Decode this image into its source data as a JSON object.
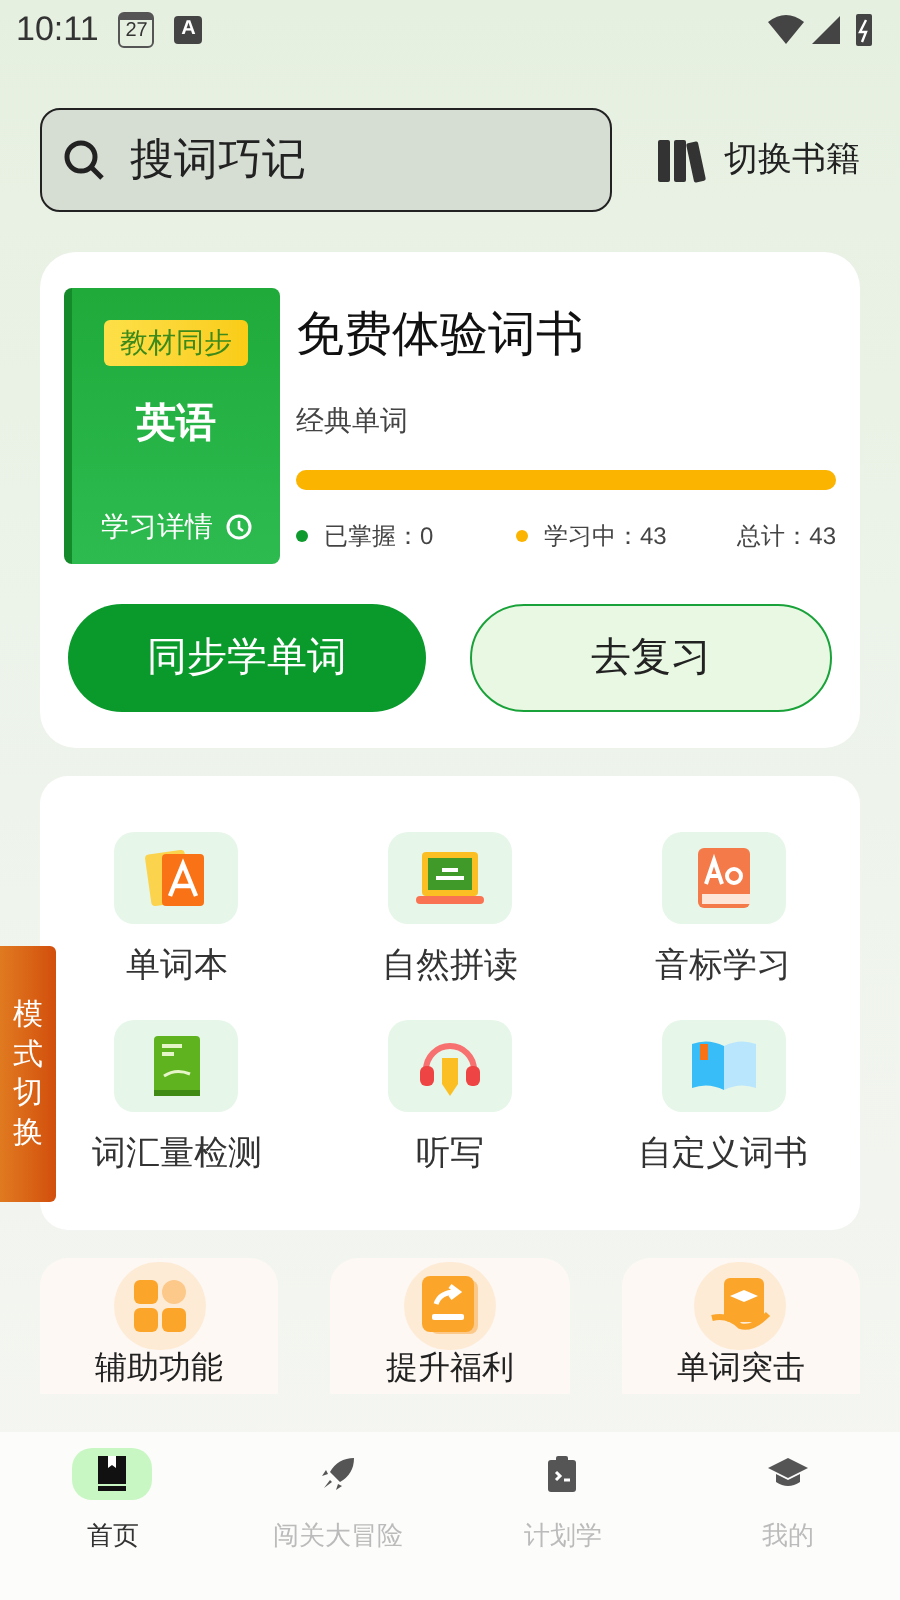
{
  "status_bar": {
    "time": "10:11",
    "calendar_day": "27",
    "notice_letter": "A"
  },
  "search": {
    "placeholder": "搜词巧记"
  },
  "switch_books": {
    "label": "切换书籍"
  },
  "book": {
    "badge": "教材同步",
    "subject": "英语",
    "details": "学习详情",
    "title": "免费体验词书",
    "subtitle": "经典单词",
    "level": 1.0,
    "legend": [
      {
        "label": "已掌握：0",
        "color": "#0f9a2e"
      },
      {
        "label": "学习中：43",
        "color": "#fbb500"
      }
    ],
    "total": "总计：43"
  },
  "actions": [
    {
      "label": "同步学单词",
      "kind": "primary"
    },
    {
      "label": "去复习",
      "kind": "secondary"
    }
  ],
  "features": [
    {
      "label": "单词本",
      "kind": "cards"
    },
    {
      "label": "自然拼读",
      "kind": "board"
    },
    {
      "label": "音标学习",
      "kind": "aa"
    },
    {
      "label": "词汇量检测",
      "kind": "notebook"
    },
    {
      "label": "听写",
      "kind": "headphones"
    },
    {
      "label": "自定义词书",
      "kind": "openbook"
    }
  ],
  "mode_switch": {
    "label": "模式切换"
  },
  "extras": [
    {
      "label": "辅助功能",
      "kind": "grid"
    },
    {
      "label": "提升福利",
      "kind": "share"
    },
    {
      "label": "单词突击",
      "kind": "cap"
    }
  ],
  "nav": [
    {
      "label": "首页",
      "kind": "book",
      "selected": true
    },
    {
      "label": "闯关大冒险",
      "kind": "rocket",
      "selected": false
    },
    {
      "label": "计划学",
      "kind": "clipboard",
      "selected": false
    },
    {
      "label": "我的",
      "kind": "cap",
      "selected": false
    }
  ]
}
